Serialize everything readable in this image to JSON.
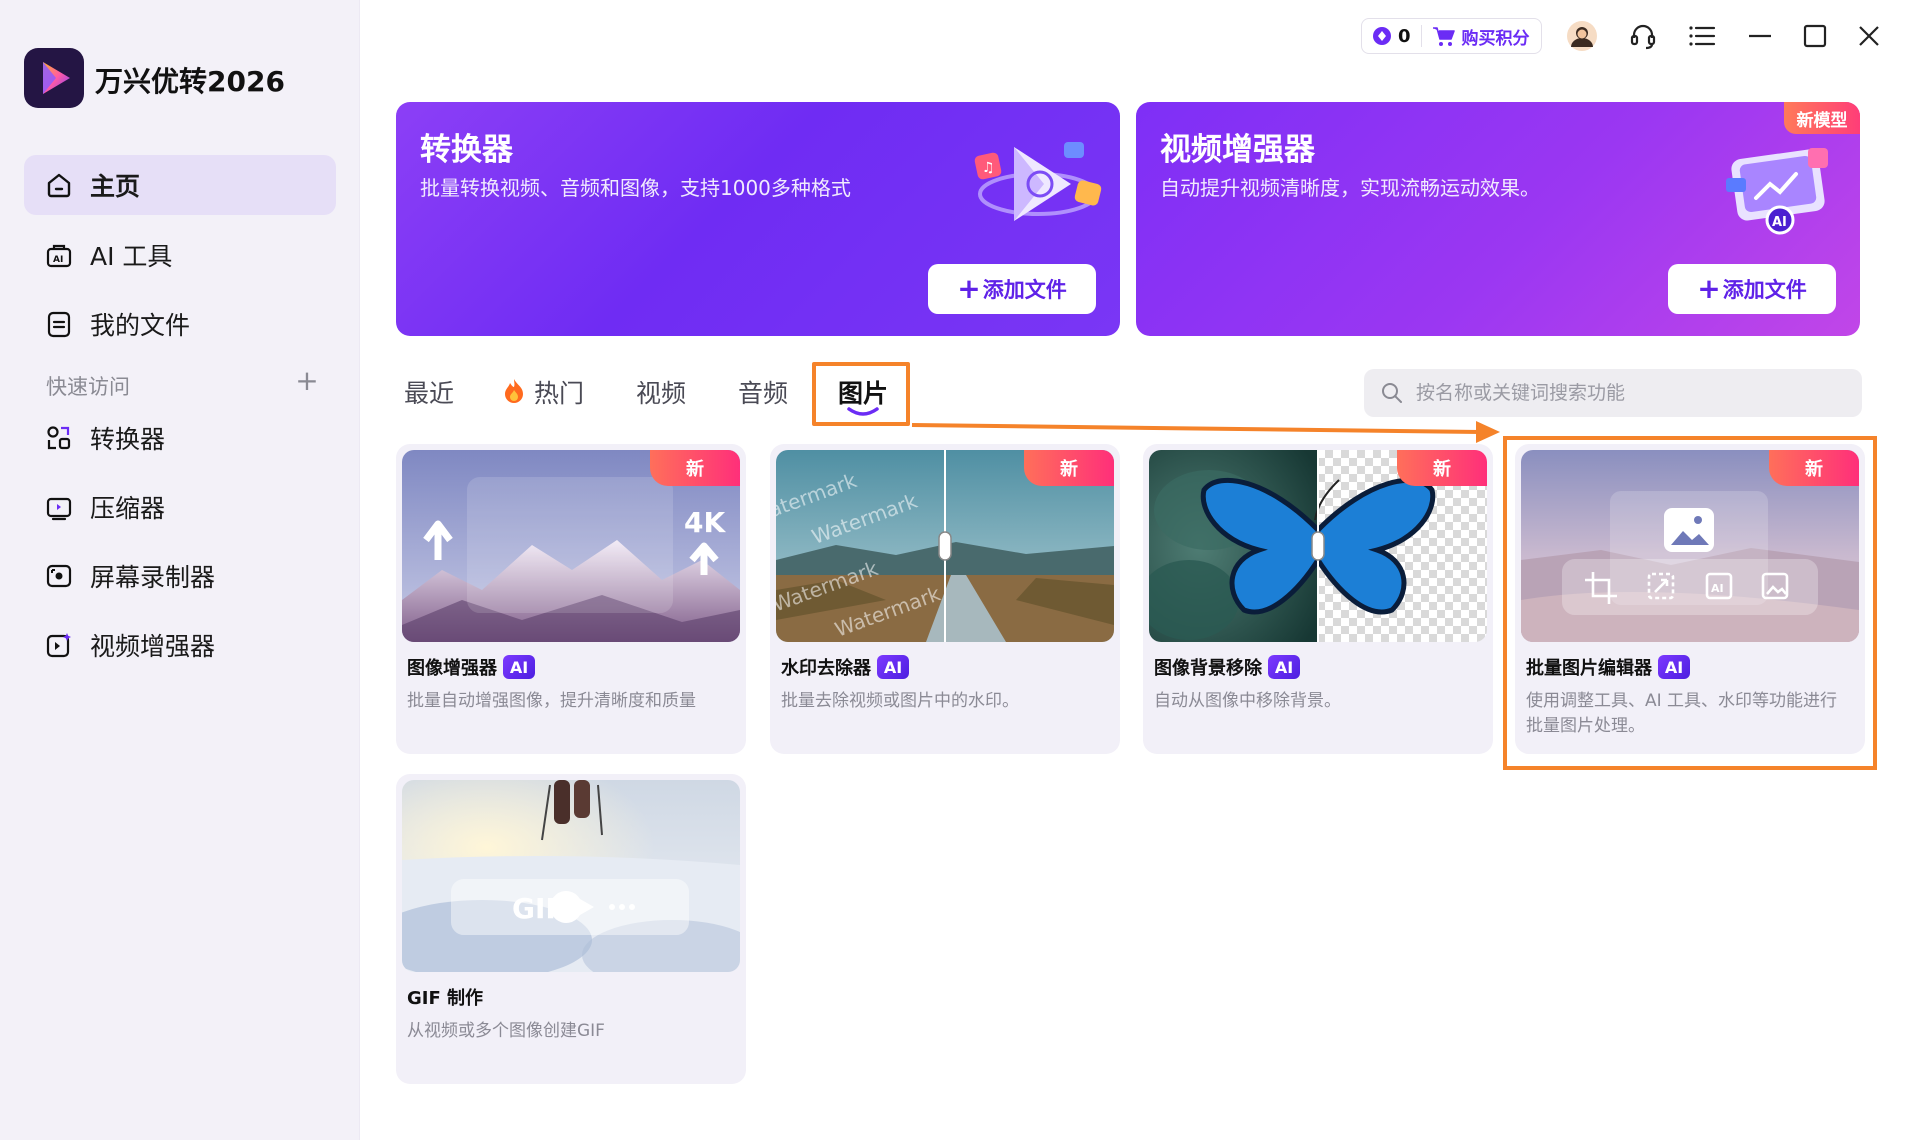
{
  "app": {
    "name": "万兴优转2026"
  },
  "sidebar": {
    "nav": [
      {
        "label": "主页",
        "icon": "home-icon"
      },
      {
        "label": "AI 工具",
        "icon": "ai-tools-icon"
      },
      {
        "label": "我的文件",
        "icon": "my-files-icon"
      }
    ],
    "quick_title": "快速访问",
    "quick_add": "+",
    "quick_items": [
      {
        "label": "转换器",
        "icon": "converter-icon"
      },
      {
        "label": "压缩器",
        "icon": "compressor-icon"
      },
      {
        "label": "屏幕录制器",
        "icon": "screen-recorder-icon"
      },
      {
        "label": "视频增强器",
        "icon": "video-enhancer-icon"
      }
    ]
  },
  "topbar": {
    "points": "0",
    "buy_label": "购买积分"
  },
  "banners": [
    {
      "title": "转换器",
      "subtitle": "批量转换视频、音频和图像，支持1000多种格式",
      "button": "添加文件",
      "plus": "+"
    },
    {
      "title": "视频增强器",
      "subtitle": "自动提升视频清晰度，实现流畅运动效果。",
      "button": "添加文件",
      "plus": "+",
      "badge": "新模型"
    }
  ],
  "tabs": [
    {
      "label": "最近"
    },
    {
      "label": "热门"
    },
    {
      "label": "视频"
    },
    {
      "label": "音频"
    },
    {
      "label": "图片",
      "active": true
    }
  ],
  "search": {
    "placeholder": "按名称或关键词搜索功能"
  },
  "cards": [
    {
      "title": "图像增强器",
      "ai": "AI",
      "new": "新",
      "desc": "批量自动增强图像，提升清晰度和质量",
      "thumb_text": "4K"
    },
    {
      "title": "水印去除器",
      "ai": "AI",
      "new": "新",
      "desc": "批量去除视频或图片中的水印。",
      "thumb_text": "Watermark"
    },
    {
      "title": "图像背景移除",
      "ai": "AI",
      "new": "新",
      "desc": "自动从图像中移除背景。"
    },
    {
      "title": "批量图片编辑器",
      "ai": "AI",
      "new": "新",
      "desc": "使用调整工具、AI 工具、水印等功能进行批量图片处理。"
    },
    {
      "title": "GIF 制作",
      "desc": "从视频或多个图像创建GIF",
      "thumb_text": "GIF"
    }
  ],
  "colors": {
    "accent": "#6b2cf5",
    "highlight": "#f5832a",
    "sidebar_bg": "#f3f1f8",
    "new_tag": "#ff3d78"
  }
}
